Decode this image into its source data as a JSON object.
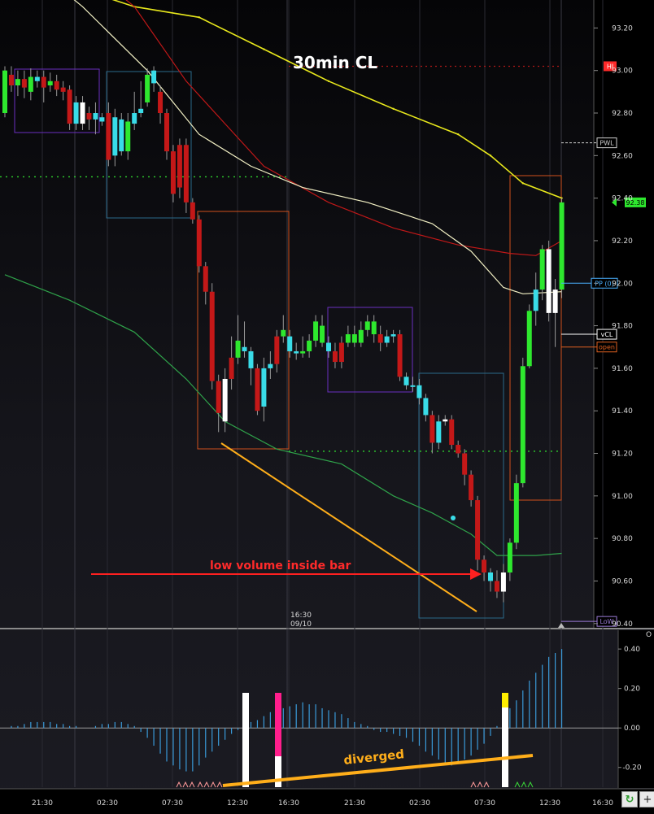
{
  "chart_title": "30min CL",
  "annotations": {
    "inside_bar": "low volume inside bar",
    "divergence": "diverged"
  },
  "controls": {
    "refresh_icon": "refresh-icon",
    "plus_label": "+",
    "corner_label": "O"
  },
  "colors": {
    "up": "#2ee82e",
    "down": "#c41818",
    "up_low_vol": "#39dce8",
    "down_low_vol": "#ffffff",
    "ma_yellow": "#e8e81c",
    "ma_red": "#c01818",
    "ma_cream": "#f2f0c4",
    "ma_green": "#2fa24a",
    "trendline": "#ffae1a",
    "arrow": "#ff2020",
    "histogram": "#3a9ad9"
  },
  "chart_data": [
    {
      "type": "candlestick",
      "title": "30min CL",
      "ylim": [
        90.38,
        93.32
      ],
      "y_ticks": [
        "93.20",
        "93.00",
        "92.80",
        "92.60",
        "92.40",
        "92.20",
        "92.00",
        "91.80",
        "91.60",
        "91.40",
        "91.20",
        "91.00",
        "90.80",
        "90.60",
        "90.40"
      ],
      "x_ticks": [
        "21:30",
        "02:30",
        "07:30",
        "12:30",
        "16:30",
        "21:30",
        "02:30",
        "07:30",
        "12:30",
        "16:30"
      ],
      "session_marker": {
        "time": "16:30",
        "date": "09/10"
      },
      "levels": [
        {
          "label": "HI",
          "value": 93.02,
          "color": "#ff2a2a"
        },
        {
          "label": "PWL",
          "value": 92.66,
          "color": "#cfcfcf"
        },
        {
          "label": "vCL",
          "value": 91.76,
          "color": "#ffffff"
        },
        {
          "label": "open",
          "value": 91.7,
          "color": "#e06020"
        },
        {
          "label": "PP (0)",
          "value": 92.0,
          "color": "#4ab0ff"
        },
        {
          "label": "LoW",
          "value": 90.41,
          "color": "#9a7ad6"
        },
        {
          "label": "92.38",
          "value": 92.38,
          "color": "#2ee82e"
        }
      ],
      "candles": [
        [
          93.0,
          92.8,
          93.02,
          92.78,
          "u"
        ],
        [
          92.98,
          92.93,
          93.02,
          92.9,
          "d"
        ],
        [
          92.93,
          92.96,
          93.0,
          92.88,
          "u"
        ],
        [
          92.96,
          92.92,
          93.0,
          92.87,
          "d"
        ],
        [
          92.9,
          92.97,
          93.01,
          92.86,
          "u"
        ],
        [
          92.95,
          92.97,
          93.0,
          92.92,
          "c"
        ],
        [
          92.97,
          92.92,
          93.0,
          92.85,
          "d"
        ],
        [
          92.93,
          92.95,
          92.99,
          92.9,
          "u"
        ],
        [
          92.95,
          92.91,
          92.98,
          92.88,
          "d"
        ],
        [
          92.92,
          92.9,
          92.95,
          92.86,
          "d"
        ],
        [
          92.91,
          92.75,
          92.93,
          92.72,
          "d"
        ],
        [
          92.75,
          92.85,
          92.88,
          92.72,
          "c"
        ],
        [
          92.85,
          92.75,
          92.88,
          92.72,
          "w"
        ],
        [
          92.8,
          92.77,
          92.83,
          92.72,
          "d"
        ],
        [
          92.77,
          92.8,
          92.85,
          92.7,
          "c"
        ],
        [
          92.78,
          92.76,
          92.8,
          92.74,
          "c"
        ],
        [
          92.8,
          92.58,
          92.85,
          92.55,
          "d"
        ],
        [
          92.6,
          92.78,
          92.82,
          92.55,
          "c"
        ],
        [
          92.77,
          92.62,
          92.8,
          92.6,
          "c"
        ],
        [
          92.62,
          92.76,
          92.8,
          92.58,
          "u"
        ],
        [
          92.75,
          92.8,
          92.9,
          92.72,
          "c"
        ],
        [
          92.8,
          92.82,
          92.95,
          92.78,
          "c"
        ],
        [
          92.85,
          92.98,
          93.01,
          92.83,
          "u"
        ],
        [
          93.0,
          92.94,
          93.02,
          92.9,
          "c"
        ],
        [
          92.9,
          92.8,
          92.93,
          92.75,
          "d"
        ],
        [
          92.8,
          92.62,
          92.82,
          92.58,
          "d"
        ],
        [
          92.62,
          92.42,
          92.65,
          92.38,
          "d"
        ],
        [
          92.45,
          92.65,
          92.68,
          92.4,
          "d"
        ],
        [
          92.65,
          92.38,
          92.68,
          92.33,
          "d"
        ],
        [
          92.38,
          92.3,
          92.4,
          92.28,
          "d"
        ],
        [
          92.3,
          92.08,
          92.32,
          92.05,
          "d"
        ],
        [
          92.08,
          91.96,
          92.1,
          91.9,
          "d"
        ],
        [
          91.96,
          91.54,
          92.0,
          91.5,
          "d"
        ],
        [
          91.54,
          91.39,
          91.57,
          91.3,
          "d"
        ],
        [
          91.35,
          91.55,
          91.6,
          91.3,
          "w"
        ],
        [
          91.55,
          91.65,
          91.75,
          91.5,
          "d"
        ],
        [
          91.65,
          91.73,
          91.85,
          91.62,
          "u"
        ],
        [
          91.7,
          91.68,
          91.82,
          91.65,
          "c"
        ],
        [
          91.68,
          91.6,
          91.7,
          91.52,
          "c"
        ],
        [
          91.6,
          91.4,
          91.62,
          91.38,
          "d"
        ],
        [
          91.42,
          91.6,
          91.65,
          91.35,
          "c"
        ],
        [
          91.6,
          91.62,
          91.68,
          91.55,
          "c"
        ],
        [
          91.62,
          91.75,
          91.78,
          91.58,
          "d"
        ],
        [
          91.75,
          91.78,
          91.85,
          91.72,
          "u"
        ],
        [
          91.75,
          91.68,
          91.78,
          91.65,
          "c"
        ],
        [
          91.68,
          91.67,
          91.72,
          91.64,
          "c"
        ],
        [
          91.67,
          91.68,
          91.75,
          91.65,
          "u"
        ],
        [
          91.68,
          91.73,
          91.76,
          91.65,
          "u"
        ],
        [
          91.73,
          91.82,
          91.85,
          91.7,
          "u"
        ],
        [
          91.8,
          91.72,
          91.85,
          91.7,
          "u"
        ],
        [
          91.72,
          91.68,
          91.75,
          91.65,
          "c"
        ],
        [
          91.68,
          91.63,
          91.72,
          91.6,
          "d"
        ],
        [
          91.63,
          91.72,
          91.75,
          91.6,
          "d"
        ],
        [
          91.72,
          91.76,
          91.8,
          91.7,
          "u"
        ],
        [
          91.76,
          91.72,
          91.8,
          91.7,
          "u"
        ],
        [
          91.72,
          91.78,
          91.82,
          91.7,
          "u"
        ],
        [
          91.78,
          91.82,
          91.85,
          91.75,
          "u"
        ],
        [
          91.82,
          91.76,
          91.85,
          91.72,
          "u"
        ],
        [
          91.76,
          91.72,
          91.8,
          91.68,
          "d"
        ],
        [
          91.72,
          91.75,
          91.78,
          91.7,
          "c"
        ],
        [
          91.75,
          91.76,
          91.78,
          91.72,
          "c"
        ],
        [
          91.76,
          91.56,
          91.78,
          91.54,
          "d"
        ],
        [
          91.56,
          91.52,
          91.58,
          91.5,
          "c"
        ],
        [
          91.52,
          91.52,
          91.56,
          91.49,
          "c"
        ],
        [
          91.52,
          91.46,
          91.55,
          91.43,
          "c"
        ],
        [
          91.46,
          91.38,
          91.48,
          91.35,
          "c"
        ],
        [
          91.38,
          91.25,
          91.4,
          91.2,
          "d"
        ],
        [
          91.25,
          91.35,
          91.38,
          91.22,
          "c"
        ],
        [
          91.35,
          91.36,
          91.38,
          91.33,
          "w"
        ],
        [
          91.36,
          91.24,
          91.38,
          91.22,
          "d"
        ],
        [
          91.24,
          91.2,
          91.26,
          91.18,
          "d"
        ],
        [
          91.2,
          91.1,
          91.22,
          91.05,
          "d"
        ],
        [
          91.1,
          90.98,
          91.12,
          90.95,
          "d"
        ],
        [
          90.98,
          90.7,
          91.0,
          90.65,
          "d"
        ],
        [
          90.7,
          90.64,
          90.72,
          90.6,
          "d"
        ],
        [
          90.64,
          90.6,
          90.66,
          90.55,
          "c"
        ],
        [
          90.6,
          90.55,
          90.65,
          90.52,
          "d"
        ],
        [
          90.55,
          90.64,
          90.68,
          90.5,
          "w"
        ],
        [
          90.64,
          90.78,
          90.8,
          90.6,
          "u"
        ],
        [
          90.78,
          91.06,
          91.1,
          90.75,
          "u"
        ],
        [
          91.06,
          91.61,
          91.65,
          91.04,
          "u"
        ],
        [
          91.61,
          91.87,
          91.9,
          91.6,
          "u"
        ],
        [
          91.87,
          91.97,
          92.05,
          91.8,
          "c"
        ],
        [
          91.97,
          92.16,
          92.18,
          91.92,
          "u"
        ],
        [
          92.16,
          91.86,
          92.2,
          91.82,
          "w"
        ],
        [
          91.86,
          91.97,
          92.02,
          91.7,
          "w"
        ],
        [
          91.97,
          92.38,
          92.4,
          91.93,
          "u"
        ]
      ],
      "series": [
        {
          "name": "",
          "color": "#e8e81c",
          "points": [
            [
              0,
              93.6
            ],
            [
              10,
              93.4
            ],
            [
              20,
              93.3
            ],
            [
              30,
              93.25
            ],
            [
              40,
              93.1
            ],
            [
              50,
              92.95
            ],
            [
              60,
              92.82
            ],
            [
              70,
              92.7
            ],
            [
              75,
              92.6
            ],
            [
              80,
              92.47
            ],
            [
              86,
              92.4
            ]
          ]
        },
        {
          "name": "",
          "color": "#c01818",
          "points": [
            [
              0,
              93.9
            ],
            [
              10,
              93.55
            ],
            [
              20,
              93.3
            ],
            [
              28,
              92.95
            ],
            [
              34,
              92.75
            ],
            [
              40,
              92.55
            ],
            [
              50,
              92.38
            ],
            [
              60,
              92.26
            ],
            [
              70,
              92.18
            ],
            [
              78,
              92.14
            ],
            [
              82,
              92.13
            ],
            [
              86,
              92.2
            ]
          ]
        },
        {
          "name": "",
          "color": "#f2f0c4",
          "points": [
            [
              0,
              93.6
            ],
            [
              12,
              93.3
            ],
            [
              22,
              93.0
            ],
            [
              30,
              92.7
            ],
            [
              38,
              92.55
            ],
            [
              46,
              92.45
            ],
            [
              56,
              92.38
            ],
            [
              66,
              92.28
            ],
            [
              72,
              92.15
            ],
            [
              77,
              91.98
            ],
            [
              80,
              91.95
            ],
            [
              86,
              91.96
            ]
          ]
        },
        {
          "name": "",
          "color": "#2fa24a",
          "points": [
            [
              0,
              92.04
            ],
            [
              10,
              91.92
            ],
            [
              20,
              91.77
            ],
            [
              28,
              91.55
            ],
            [
              34,
              91.35
            ],
            [
              42,
              91.22
            ],
            [
              52,
              91.15
            ],
            [
              60,
              91.0
            ],
            [
              66,
              90.92
            ],
            [
              72,
              90.82
            ],
            [
              76,
              90.72
            ],
            [
              82,
              90.72
            ],
            [
              86,
              90.73
            ]
          ]
        }
      ]
    },
    {
      "type": "bar",
      "ylim": [
        -0.3,
        0.45
      ],
      "y_ticks": [
        "0.40",
        "0.20",
        "0.00",
        "-0.20"
      ],
      "highlights": [
        {
          "index": 28,
          "color": "#ffffff"
        },
        {
          "index": 33,
          "color": "#ff1e8c"
        },
        {
          "index": 74,
          "color": "#ffee00"
        }
      ],
      "values": [
        0.0,
        0.01,
        0.01,
        0.02,
        0.03,
        0.03,
        0.03,
        0.03,
        0.02,
        0.02,
        0.01,
        0.01,
        0.0,
        0.0,
        0.01,
        0.02,
        0.02,
        0.03,
        0.03,
        0.02,
        0.01,
        -0.02,
        -0.05,
        -0.09,
        -0.13,
        -0.17,
        -0.19,
        -0.21,
        -0.22,
        -0.22,
        -0.19,
        -0.15,
        -0.12,
        -0.09,
        -0.06,
        -0.03,
        -0.01,
        0.01,
        0.03,
        0.04,
        0.06,
        0.08,
        0.09,
        0.1,
        0.11,
        0.12,
        0.13,
        0.12,
        0.12,
        0.1,
        0.09,
        0.08,
        0.07,
        0.05,
        0.03,
        0.02,
        0.01,
        -0.01,
        -0.02,
        -0.02,
        -0.03,
        -0.04,
        -0.05,
        -0.07,
        -0.09,
        -0.12,
        -0.14,
        -0.16,
        -0.18,
        -0.19,
        -0.18,
        -0.16,
        -0.14,
        -0.11,
        -0.08,
        -0.04,
        0.01,
        0.05,
        0.1,
        0.14,
        0.19,
        0.24,
        0.28,
        0.32,
        0.36,
        0.38,
        0.4
      ]
    }
  ]
}
